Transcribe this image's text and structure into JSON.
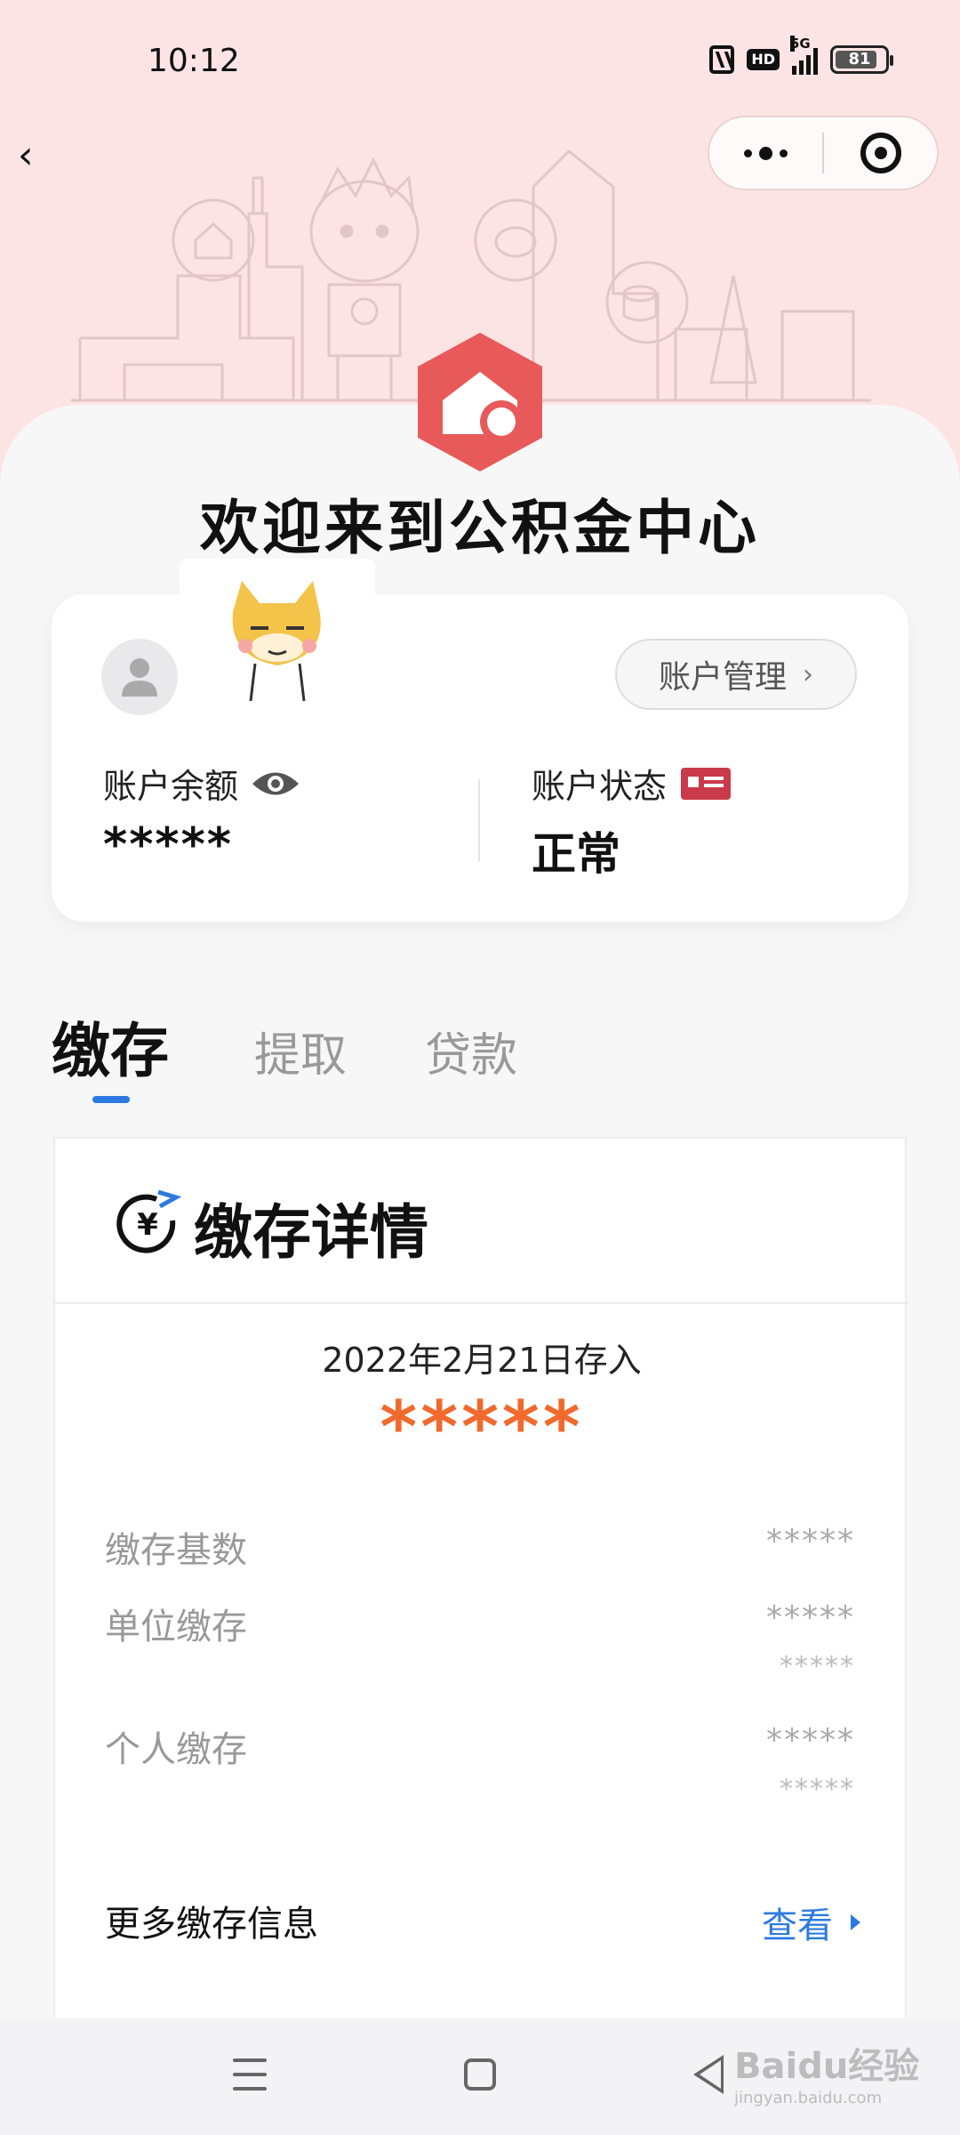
{
  "status_bar": {
    "time": "10:12",
    "hd": "HD",
    "network": "5G",
    "battery": "81"
  },
  "nav": {
    "back_glyph": "‹"
  },
  "header": {
    "welcome": "欢迎来到公积金中心"
  },
  "account": {
    "manage_label": "账户管理",
    "manage_chevron": "›",
    "balance_label": "账户余额",
    "balance_value": "*****",
    "status_label": "账户状态",
    "status_value": "正常"
  },
  "tabs": [
    {
      "label": "缴存",
      "active": true
    },
    {
      "label": "提取",
      "active": false
    },
    {
      "label": "贷款",
      "active": false
    }
  ],
  "detail": {
    "title": "缴存详情",
    "date_text": "2022年2月21日存入",
    "amount": "*****",
    "rows": [
      {
        "label": "缴存基数",
        "value": "*****"
      },
      {
        "label": "单位缴存",
        "value": "*****",
        "sub": "*****"
      },
      {
        "label": "个人缴存",
        "value": "*****",
        "sub": "*****"
      }
    ],
    "more_label": "更多缴存信息",
    "view_label": "查看"
  },
  "watermark": {
    "brand": "Baidu经验",
    "url": "jingyan.baidu.com"
  },
  "colors": {
    "accent_blue": "#2c7ae0",
    "amount_orange": "#f06a2e",
    "logo_red": "#e85a5a",
    "hero_pink": "#fde4e4"
  }
}
